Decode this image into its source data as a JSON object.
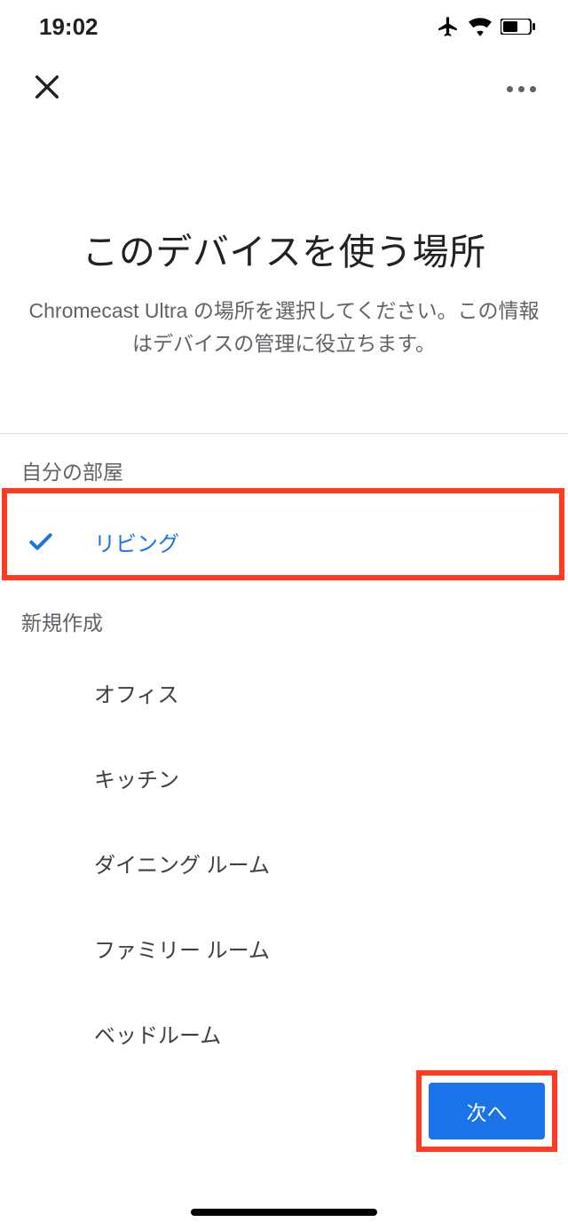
{
  "status": {
    "time": "19:02"
  },
  "heading": {
    "title": "このデバイスを使う場所",
    "subtitle": "Chromecast Ultra の場所を選択してください。この情報はデバイスの管理に役立ちます。"
  },
  "sections": {
    "my_rooms": {
      "header": "自分の部屋",
      "items": [
        {
          "label": "リビング",
          "selected": true
        }
      ]
    },
    "create_new": {
      "header": "新規作成",
      "items": [
        {
          "label": "オフィス"
        },
        {
          "label": "キッチン"
        },
        {
          "label": "ダイニング ルーム"
        },
        {
          "label": "ファミリー ルーム"
        },
        {
          "label": "ベッドルーム"
        }
      ]
    }
  },
  "next_label": "次へ",
  "colors": {
    "accent": "#1a73e8",
    "highlight": "#ff3b24"
  }
}
